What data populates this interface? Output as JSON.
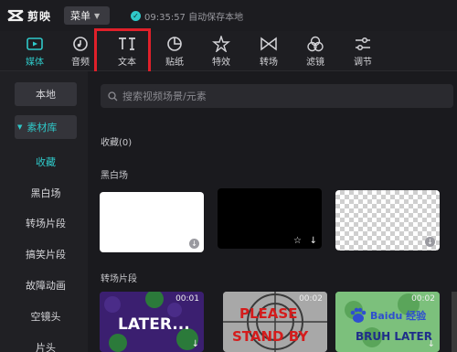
{
  "app": {
    "name": "剪映"
  },
  "topbar": {
    "menu_label": "菜单",
    "autosave": "09:35:57 自动保存本地"
  },
  "tools": [
    {
      "label": "媒体",
      "icon": "media-icon",
      "active": true
    },
    {
      "label": "音频",
      "icon": "audio-icon"
    },
    {
      "label": "文本",
      "icon": "text-icon"
    },
    {
      "label": "贴纸",
      "icon": "sticker-icon"
    },
    {
      "label": "特效",
      "icon": "effects-icon"
    },
    {
      "label": "转场",
      "icon": "transition-icon"
    },
    {
      "label": "滤镜",
      "icon": "filter-icon"
    },
    {
      "label": "调节",
      "icon": "adjust-icon"
    }
  ],
  "sidebar": {
    "local": "本地",
    "library": "素材库",
    "items": [
      "收藏",
      "黑白场",
      "转场片段",
      "搞笑片段",
      "故障动画",
      "空镜头",
      "片头"
    ]
  },
  "search": {
    "placeholder": "搜索视频场景/元素"
  },
  "sections": {
    "favorites": "收藏(0)",
    "black_white": "黑白场",
    "transition_clips": "转场片段"
  },
  "cards": {
    "transition": [
      {
        "duration": "00:01",
        "text": "LATER..."
      },
      {
        "duration": "00:02",
        "text_line1": "PLEASE",
        "text_line2": "STAND BY"
      },
      {
        "duration": "00:02",
        "text": "BRUH LATER"
      }
    ]
  },
  "watermark": "Baidu 经验",
  "colors": {
    "accent": "#2fc9c9",
    "highlight_box": "#e0202a",
    "background": "#1a1a1e"
  }
}
